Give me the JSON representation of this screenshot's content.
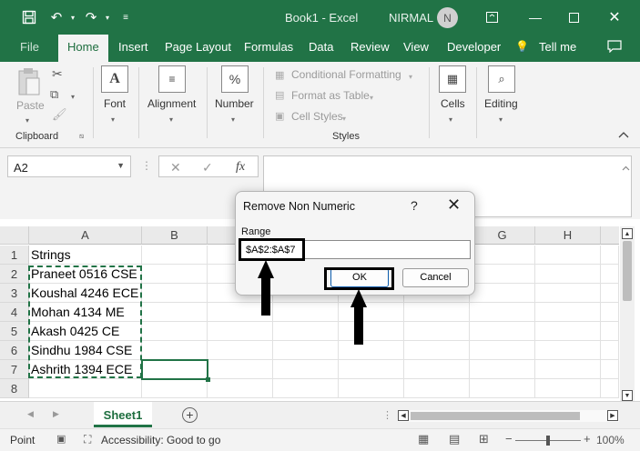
{
  "titlebar": {
    "title": "Book1  -  Excel",
    "user": "NIRMAL",
    "avatar_initial": "N"
  },
  "tabs": [
    "File",
    "Home",
    "Insert",
    "Page Layout",
    "Formulas",
    "Data",
    "Review",
    "View",
    "Developer",
    "Tell me"
  ],
  "ribbon": {
    "clipboard": {
      "paste": "Paste",
      "group": "Clipboard"
    },
    "font": "Font",
    "alignment": "Alignment",
    "number": "Number",
    "styles": {
      "conditional": "Conditional Formatting",
      "format_table": "Format as Table",
      "cell_styles": "Cell Styles",
      "group": "Styles"
    },
    "cells": "Cells",
    "editing": "Editing"
  },
  "formula_bar": {
    "name_box": "A2",
    "fx": "fx",
    "formula": ""
  },
  "columns": [
    "A",
    "B",
    "C",
    "D",
    "E",
    "F",
    "G",
    "H"
  ],
  "rows": [
    "1",
    "2",
    "3",
    "4",
    "5",
    "6",
    "7",
    "8"
  ],
  "cells_a": [
    "Strings",
    "Praneet 0516 CSE",
    "Koushal 4246 ECE",
    "Mohan 4134 ME",
    "Akash 0425 CE",
    "Sindhu 1984 CSE",
    "Ashrith 1394 ECE",
    ""
  ],
  "sheet": {
    "tab": "Sheet1"
  },
  "status": {
    "mode": "Point",
    "accessibility": "Accessibility: Good to go",
    "zoom": "100%"
  },
  "dialog": {
    "title": "Remove Non Numeric",
    "help": "?",
    "label": "Range",
    "value": "$A$2:$A$7",
    "ok": "OK",
    "cancel": "Cancel"
  },
  "colors": {
    "accent": "#217346"
  }
}
